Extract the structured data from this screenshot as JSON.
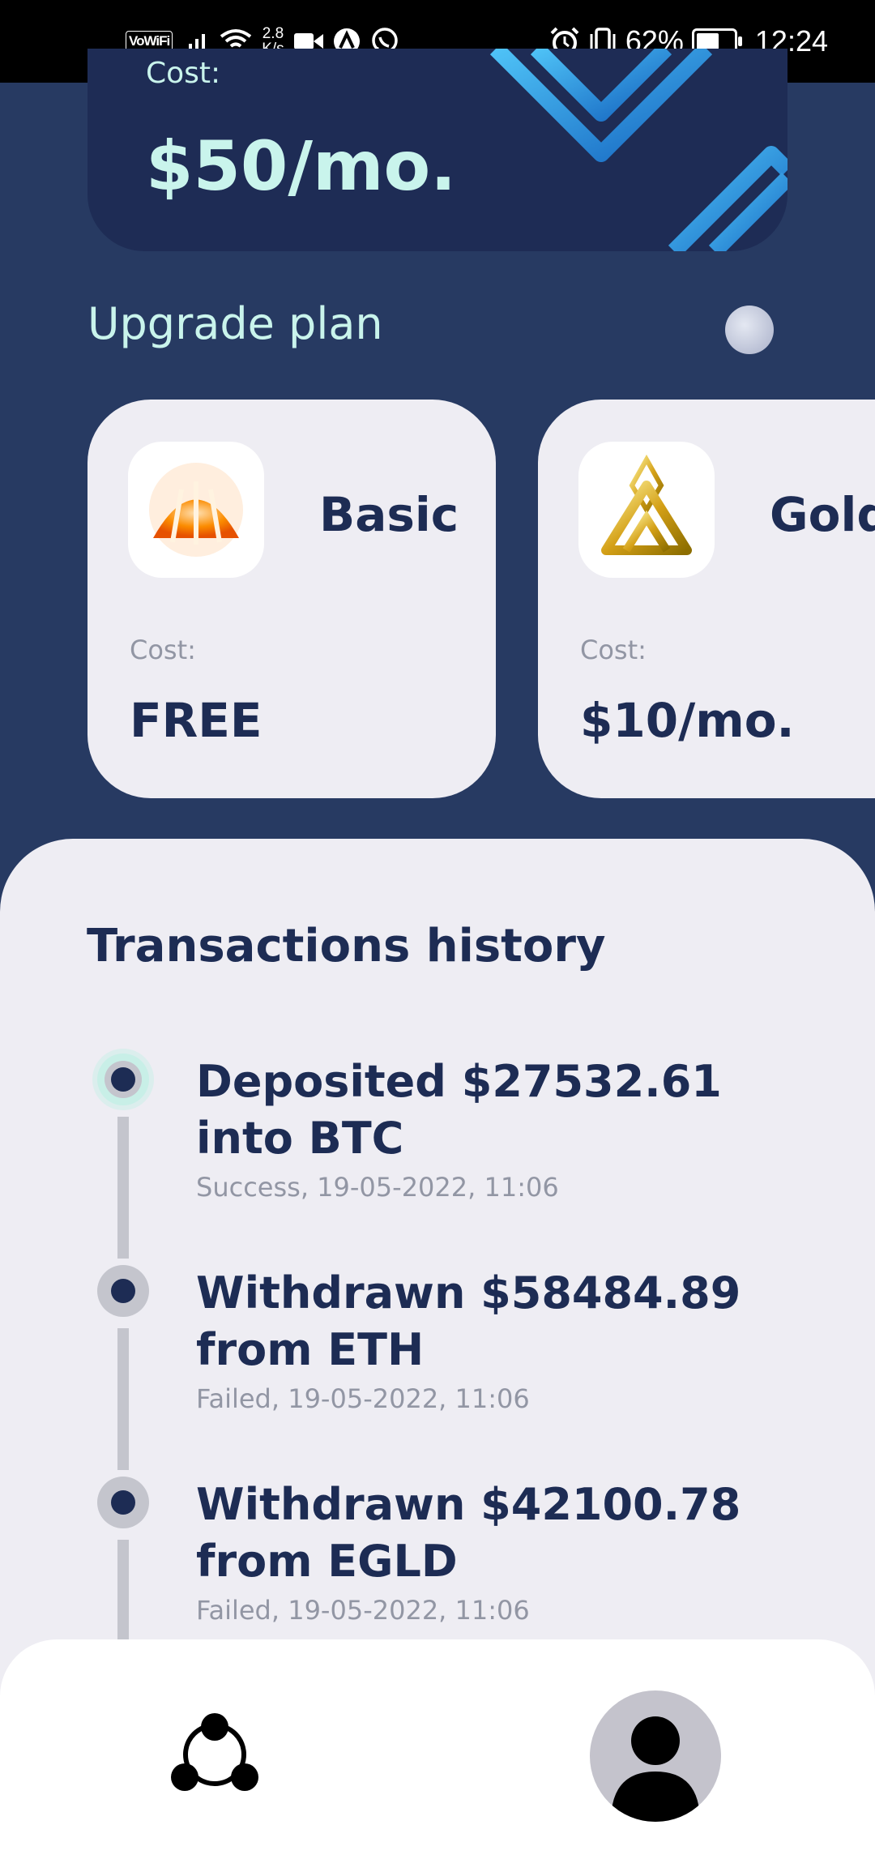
{
  "status_bar": {
    "carrier_badge": "VoWiFi",
    "speed_value": "2.8",
    "speed_unit": "K/s",
    "battery_percent": "62%",
    "time": "12:24",
    "battery_level": 0.62
  },
  "current_plan": {
    "cost_label": "Cost:",
    "price": "$50/mo."
  },
  "upgrade": {
    "title": "Upgrade plan",
    "plans": [
      {
        "name": "Basic",
        "cost_label": "Cost:",
        "price": "FREE",
        "icon": "basic-plan-logo-icon"
      },
      {
        "name": "Gold",
        "cost_label": "Cost:",
        "price": "$10/mo.",
        "icon": "gold-plan-logo-icon"
      }
    ]
  },
  "transactions": {
    "title": "Transactions history",
    "items": [
      {
        "title": "Deposited $27532.61\ninto BTC",
        "meta": "Success, 19-05-2022, 11:06"
      },
      {
        "title": "Withdrawn $58484.89\nfrom ETH",
        "meta": "Failed, 19-05-2022, 11:06"
      },
      {
        "title": "Withdrawn $42100.78\nfrom EGLD",
        "meta": "Failed, 19-05-2022, 11:06"
      }
    ]
  },
  "bottom_nav": {
    "items": [
      {
        "icon": "network-icon"
      },
      {
        "icon": "profile-icon"
      }
    ]
  },
  "colors": {
    "background": "#273A62",
    "accent_text": "#C9F4EC",
    "dark_text": "#1D2C54",
    "card": "#EEEDF3"
  }
}
